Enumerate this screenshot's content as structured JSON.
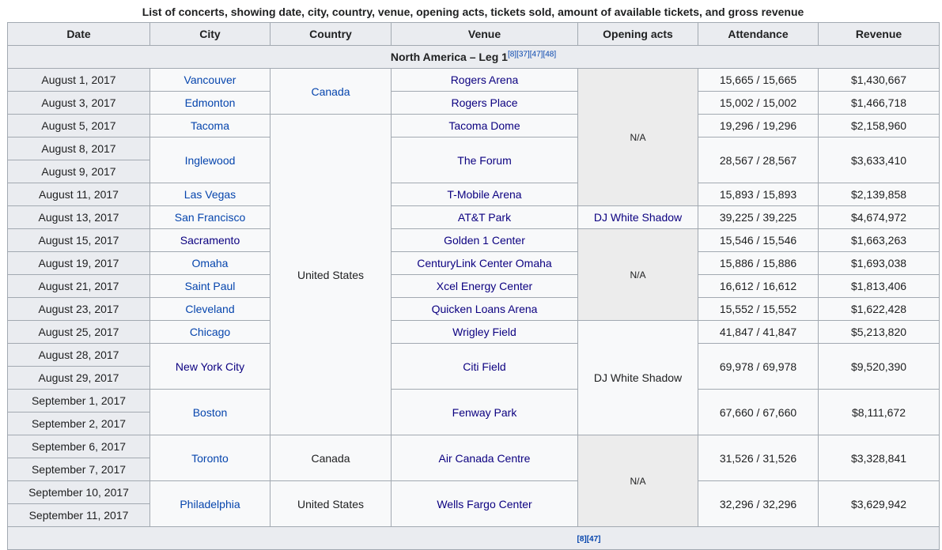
{
  "caption": "List of concerts, showing date, city, country, venue, opening acts, tickets sold, amount of available tickets, and gross revenue",
  "columns": [
    "Date",
    "City",
    "Country",
    "Venue",
    "Opening acts",
    "Attendance",
    "Revenue"
  ],
  "leg": {
    "title": "North America – Leg 1",
    "refs": [
      "[8]",
      "[37]",
      "[47]",
      "[48]"
    ]
  },
  "footer_refs": "[8][47]",
  "rows": [
    {
      "date": "August 1, 2017",
      "city": "Vancouver",
      "country": "Canada",
      "venue": "Rogers Arena",
      "opening": "N/A",
      "attendance": "15,665 / 15,665",
      "revenue": "$1,430,667"
    },
    {
      "date": "August 3, 2017",
      "city": "Edmonton",
      "venue": "Rogers Place",
      "attendance": "15,002 / 15,002",
      "revenue": "$1,466,718"
    },
    {
      "date": "August 5, 2017",
      "city": "Tacoma",
      "country": "United States",
      "venue": "Tacoma Dome",
      "attendance": "19,296 / 19,296",
      "revenue": "$2,158,960"
    },
    {
      "date": "August 8, 2017",
      "city": "Inglewood",
      "venue": "The Forum",
      "attendance": "28,567 / 28,567",
      "revenue": "$3,633,410"
    },
    {
      "date": "August 9, 2017"
    },
    {
      "date": "August 11, 2017",
      "city": "Las Vegas",
      "venue": "T-Mobile Arena",
      "attendance": "15,893 / 15,893",
      "revenue": "$2,139,858"
    },
    {
      "date": "August 13, 2017",
      "city": "San Francisco",
      "venue": "AT&T Park",
      "opening": "DJ White Shadow",
      "attendance": "39,225 / 39,225",
      "revenue": "$4,674,972"
    },
    {
      "date": "August 15, 2017",
      "city": "Sacramento",
      "venue": "Golden 1 Center",
      "opening": "N/A",
      "attendance": "15,546 / 15,546",
      "revenue": "$1,663,263"
    },
    {
      "date": "August 19, 2017",
      "city": "Omaha",
      "venue": "CenturyLink Center Omaha",
      "attendance": "15,886 / 15,886",
      "revenue": "$1,693,038"
    },
    {
      "date": "August 21, 2017",
      "city": "Saint Paul",
      "venue": "Xcel Energy Center",
      "attendance": "16,612 / 16,612",
      "revenue": "$1,813,406"
    },
    {
      "date": "August 23, 2017",
      "city": "Cleveland",
      "venue": "Quicken Loans Arena",
      "attendance": "15,552 / 15,552",
      "revenue": "$1,622,428"
    },
    {
      "date": "August 25, 2017",
      "city": "Chicago",
      "venue": "Wrigley Field",
      "opening": "DJ White Shadow",
      "attendance": "41,847 / 41,847",
      "revenue": "$5,213,820"
    },
    {
      "date": "August 28, 2017",
      "city": "New York City",
      "venue": "Citi Field",
      "attendance": "69,978 / 69,978",
      "revenue": "$9,520,390"
    },
    {
      "date": "August 29, 2017"
    },
    {
      "date": "September 1, 2017",
      "city": "Boston",
      "venue": "Fenway Park",
      "attendance": "67,660 / 67,660",
      "revenue": "$8,111,672"
    },
    {
      "date": "September 2, 2017"
    },
    {
      "date": "September 6, 2017",
      "city": "Toronto",
      "country": "Canada",
      "venue": "Air Canada Centre",
      "opening": "N/A",
      "attendance": "31,526 / 31,526",
      "revenue": "$3,328,841"
    },
    {
      "date": "September 7, 2017"
    },
    {
      "date": "September 10, 2017",
      "city": "Philadelphia",
      "country": "United States",
      "venue": "Wells Fargo Center",
      "attendance": "32,296 / 32,296",
      "revenue": "$3,629,942"
    },
    {
      "date": "September 11, 2017"
    }
  ]
}
